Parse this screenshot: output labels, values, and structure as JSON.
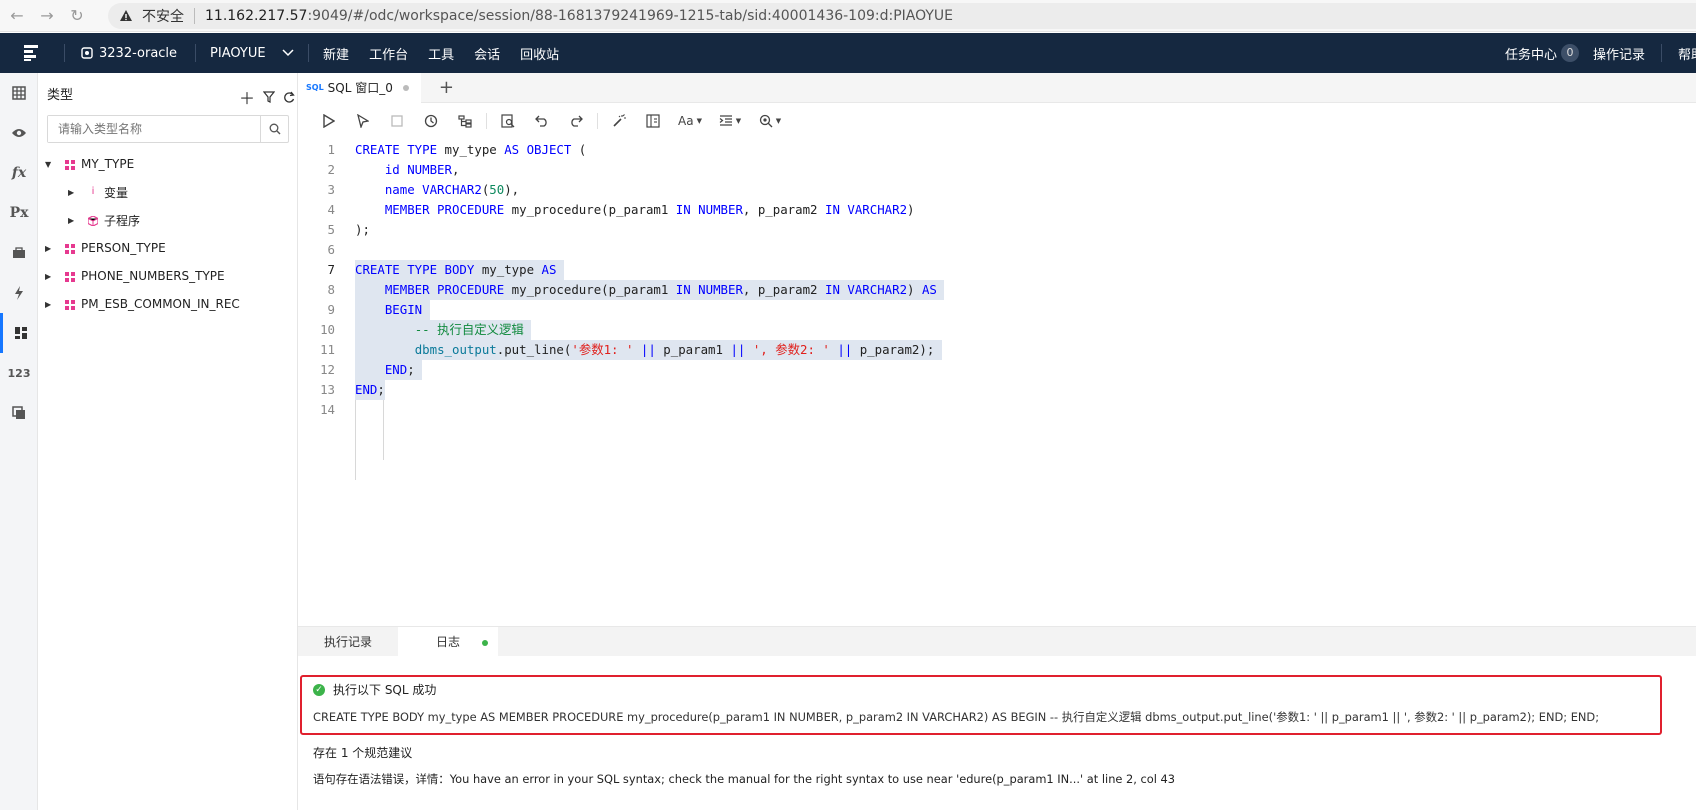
{
  "browser": {
    "insecure_label": "不安全",
    "url_host": "11.162.217.57",
    "url_rest": ":9049/#/odc/workspace/session/88-1681379241969-1215-tab/sid:40001436-109:d:PIAOYUE"
  },
  "header": {
    "connection": "3232-oracle",
    "schema": "PIAOYUE",
    "menu": [
      "新建",
      "工作台",
      "工具",
      "会话",
      "回收站"
    ],
    "task_center": "任务中心",
    "task_count": "0",
    "op_log": "操作记录",
    "help": "帮助"
  },
  "panel": {
    "title": "类型",
    "search_placeholder": "请输入类型名称",
    "tree": [
      {
        "label": "MY_TYPE",
        "level": 0,
        "expanded": true
      },
      {
        "label": "变量",
        "level": 1,
        "expanded": false
      },
      {
        "label": "子程序",
        "level": 1,
        "expanded": false
      },
      {
        "label": "PERSON_TYPE",
        "level": 0,
        "expanded": false
      },
      {
        "label": "PHONE_NUMBERS_TYPE",
        "level": 0,
        "expanded": false
      },
      {
        "label": "PM_ESB_COMMON_IN_REC",
        "level": 0,
        "expanded": false
      }
    ]
  },
  "editor": {
    "tab_label": "SQL 窗口_0",
    "sql_badge": "SQL",
    "toolbar_font_label": "Aa",
    "line_numbers": [
      "1",
      "2",
      "3",
      "4",
      "5",
      "6",
      "7",
      "8",
      "9",
      "10",
      "11",
      "12",
      "13",
      "14"
    ]
  },
  "bottom": {
    "tab_history": "执行记录",
    "tab_log": "日志",
    "success_label": "执行以下 SQL 成功",
    "executed_sql": "CREATE TYPE BODY my_type AS MEMBER PROCEDURE my_procedure(p_param1 IN NUMBER, p_param2 IN VARCHAR2) AS BEGIN -- 执行自定义逻辑 dbms_output.put_line('参数1: ' || p_param1 || ', 参数2: ' || p_param2); END; END;",
    "suggestion": "存在 1 个规范建议",
    "error": "语句存在语法错误，详情：You have an error in your SQL syntax; check the manual for the right syntax to use near 'edure(p_param1 IN...' at line 2, col 43"
  },
  "colors": {
    "header_bg": "#152840",
    "accent": "#1677ff",
    "success": "#3cb34a",
    "highlight_box": "#e0202e"
  }
}
